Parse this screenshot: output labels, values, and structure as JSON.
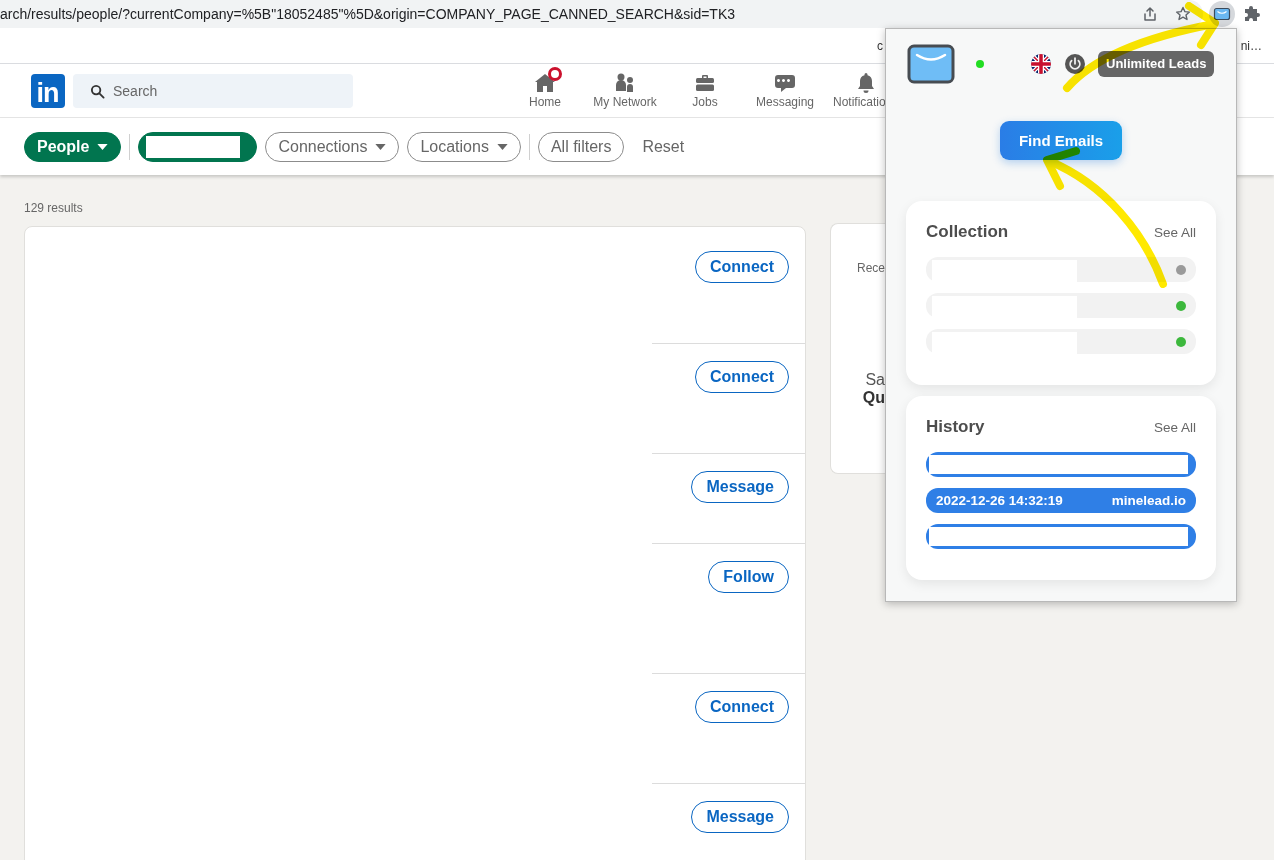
{
  "browser": {
    "url": "arch/results/people/?currentCompany=%5B\"18052485\"%5D&origin=COMPANY_PAGE_CANNED_SEARCH&sid=TK3",
    "extensions": [
      {
        "kind": "mail",
        "active": true
      },
      {
        "kind": "puzzle",
        "active": false
      }
    ],
    "bookmarks": [
      "c",
      "ni…"
    ]
  },
  "header": {
    "logo": "in",
    "search": {
      "placeholder": "Search"
    },
    "nav": [
      {
        "kind": "home",
        "label": "Home",
        "notification": true
      },
      {
        "kind": "network",
        "label": "My Network",
        "notification": false
      },
      {
        "kind": "jobs",
        "label": "Jobs",
        "notification": false
      },
      {
        "kind": "messaging",
        "label": "Messaging",
        "notification": false
      },
      {
        "kind": "bell",
        "label": "Notificatio",
        "notification": false
      }
    ]
  },
  "filters": [
    {
      "kind": "dropdown",
      "label": "People",
      "selected": true
    },
    {
      "kind": "divider"
    },
    {
      "kind": "redacted",
      "selected": true
    },
    {
      "kind": "dropdown",
      "label": "Connections",
      "selected": false
    },
    {
      "kind": "dropdown",
      "label": "Locations",
      "selected": false
    },
    {
      "kind": "divider"
    },
    {
      "kind": "button",
      "label": "All filters",
      "selected": false
    },
    {
      "kind": "link",
      "label": "Reset"
    }
  ],
  "results": {
    "count": "129 results",
    "rows": [
      {
        "action": "Connect"
      },
      {
        "action": "Connect"
      },
      {
        "action": "Message"
      },
      {
        "action": "Follow"
      },
      {
        "action": "Connect"
      },
      {
        "action": "Message"
      }
    ]
  },
  "side_card": {
    "lines": [
      {
        "kind": "caption",
        "text": "Rece"
      },
      {
        "kind": "text",
        "text": "Sa"
      },
      {
        "kind": "title",
        "text": "Qu"
      }
    ]
  },
  "extension_popup": {
    "online": true,
    "plan": "Unlimited Leads",
    "action": "Find Emails",
    "collection": {
      "title": "Collection",
      "see_all": "See All",
      "items": [
        {
          "kind": "redacted",
          "color": "#9a9a9a"
        },
        {
          "kind": "redacted",
          "color": "#3db83d"
        },
        {
          "kind": "redacted",
          "color": "#3db83d"
        }
      ]
    },
    "history": {
      "title": "History",
      "see_all": "See All",
      "items": [
        {
          "kind": "redacted"
        },
        {
          "kind": "entry",
          "date": "2022-12-26 14:32:19",
          "domain": "minelead.io"
        },
        {
          "kind": "redacted"
        }
      ]
    }
  }
}
